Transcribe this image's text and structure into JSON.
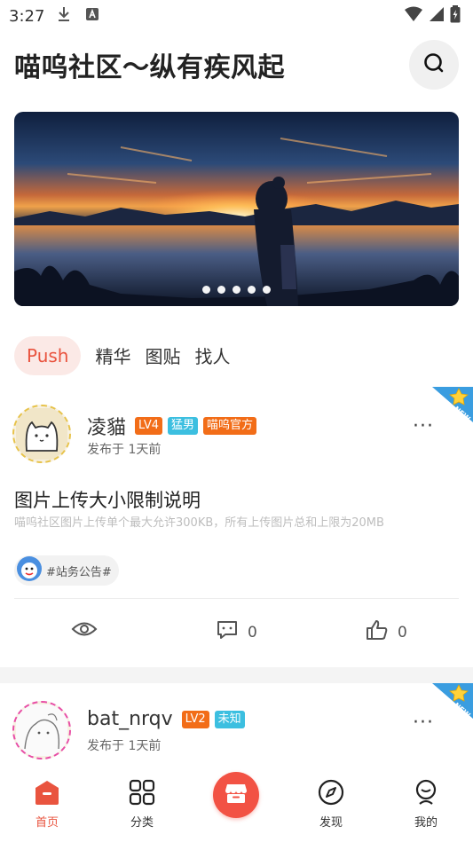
{
  "status": {
    "time": "3:27"
  },
  "header": {
    "title": "喵呜社区～纵有疾风起"
  },
  "banner": {
    "dot_count": 5
  },
  "tabs": [
    {
      "label": "Push",
      "active": true
    },
    {
      "label": "精华",
      "active": false
    },
    {
      "label": "图贴",
      "active": false
    },
    {
      "label": "找人",
      "active": false
    }
  ],
  "posts": [
    {
      "username": "凌貓",
      "level": "LV4",
      "gender_tag": "猛男",
      "role_tag": "喵呜官方",
      "time": "发布于 1天前",
      "title": "图片上传大小限制说明",
      "summary": "喵呜社区图片上传单个最大允许300KB，所有上传图片总和上限为20MB",
      "topic": "#站务公告#",
      "comments": "0",
      "likes": "0",
      "more": "···"
    },
    {
      "username": "bat_nrqv",
      "level": "LV2",
      "gender_tag": "未知",
      "time": "发布于 1天前",
      "more": "···"
    }
  ],
  "bottom_nav": [
    {
      "label": "首页",
      "icon": "home-icon",
      "active": true
    },
    {
      "label": "分类",
      "icon": "grid-icon",
      "active": false
    },
    {
      "label": "",
      "icon": "shop-icon",
      "active": false
    },
    {
      "label": "发现",
      "icon": "compass-icon",
      "active": false
    },
    {
      "label": "我的",
      "icon": "profile-icon",
      "active": false
    }
  ],
  "colors": {
    "accent": "#e9543f",
    "lv_badge": "#f26d18",
    "gender_badge": "#3cbfe0",
    "tab_active_bg": "#fbe9e6"
  }
}
